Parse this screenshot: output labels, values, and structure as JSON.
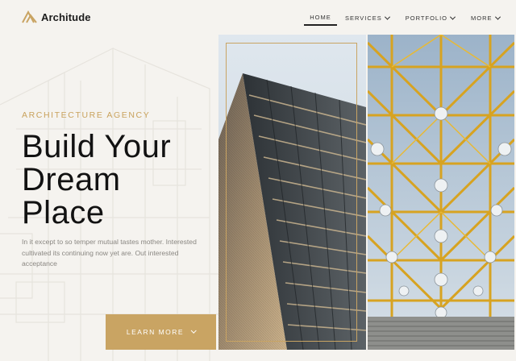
{
  "brand": {
    "name": "Architude",
    "logo_icon": "triangle-stripes-logo",
    "accent": "#c9a463"
  },
  "nav": {
    "items": [
      {
        "label": "HOME",
        "active": true,
        "has_dropdown": false
      },
      {
        "label": "SERVICES",
        "active": false,
        "has_dropdown": true
      },
      {
        "label": "PORTFOLIO",
        "active": false,
        "has_dropdown": true
      },
      {
        "label": "MORE",
        "active": false,
        "has_dropdown": true
      }
    ]
  },
  "hero": {
    "eyebrow": "ARCHITECTURE AGENCY",
    "headline_lines": [
      "Build Your",
      "Dream",
      "Place"
    ],
    "body": "In it except to so temper mutual tastes mother. Interested cultivated its continuing now yet are. Out interested acceptance",
    "cta_label": "LEARN MORE",
    "cta_icon": "chevron-down-icon"
  },
  "images": [
    {
      "name": "skyscraper-photo"
    },
    {
      "name": "yellow-steel-structure-photo"
    }
  ]
}
